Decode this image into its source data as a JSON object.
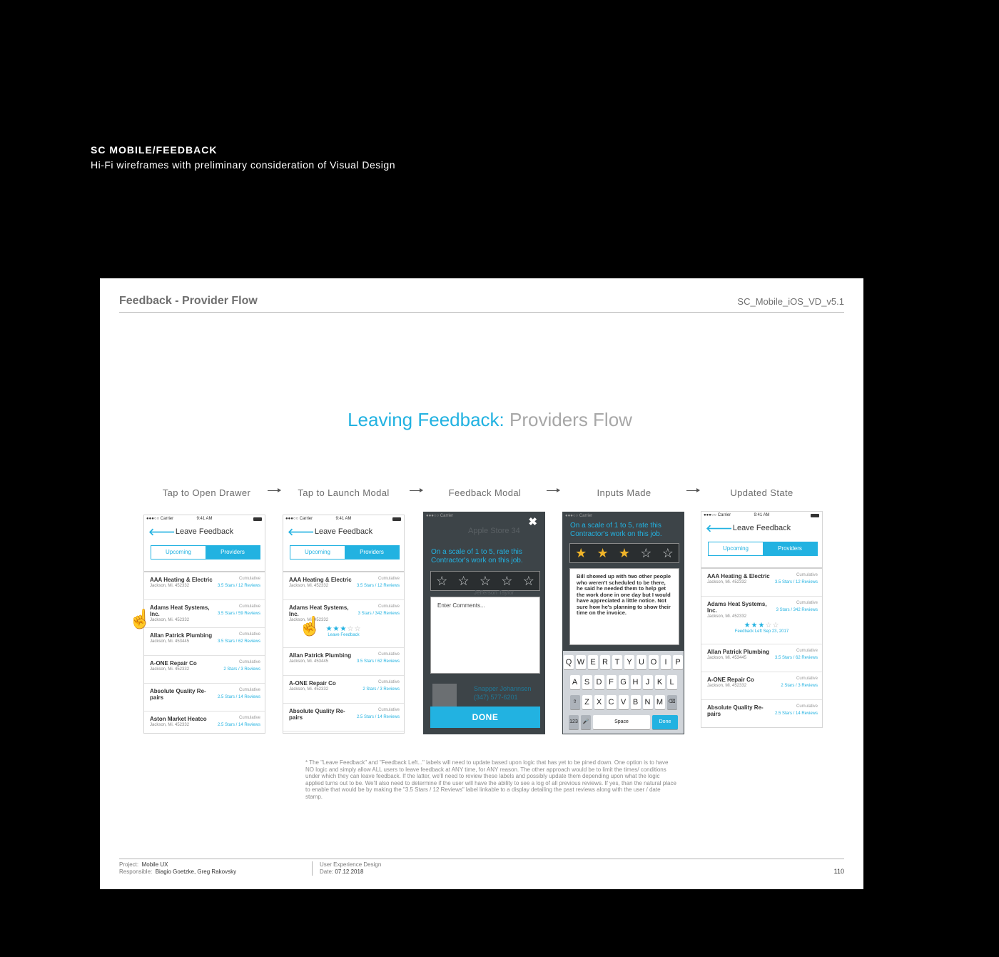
{
  "header": {
    "title": "SC MOBILE/FEEDBACK",
    "subtitle": "Hi-Fi wireframes with preliminary consideration of Visual Design"
  },
  "sheet": {
    "title": "Feedback - Provider Flow",
    "doc_id": "SC_Mobile_iOS_VD_v5.1",
    "heading_accent": "Leaving Feedback:",
    "heading_rest": " Providers Flow"
  },
  "steps": [
    "Tap to Open Drawer",
    "Tap to Launch Modal",
    "Feedback Modal",
    "Inputs Made",
    "Updated State"
  ],
  "phone": {
    "carrier": "●●●○○ Carrier",
    "time": "9:41 AM",
    "nav_title": "Leave Feedback",
    "tab_upcoming": "Upcoming",
    "tab_providers": "Providers",
    "cumulative": "Cumulative"
  },
  "screen1": {
    "rows": [
      {
        "name": "AAA Heating & Electric",
        "loc": "Jackson, Mi. 452332",
        "rating": "3.5 Stars  /  12 Reviews"
      },
      {
        "name": "Adams Heat Systems, Inc.",
        "loc": "Jackson, Mi. 452332",
        "rating": "3.5 Stars  /  59 Reviews"
      },
      {
        "name": "Allan Patrick Plumbing",
        "loc": "Jackson, Mi. 453445",
        "rating": "3.5 Stars  /  62 Reviews"
      },
      {
        "name": "A-ONE Repair Co",
        "loc": "Jackson, Mi. 452332",
        "rating": "2 Stars  /  3 Reviews"
      },
      {
        "name": "Absolute Quality Re-pairs",
        "loc": "",
        "rating": "2.5 Stars  /  14 Reviews"
      },
      {
        "name": "Aston Market Heatco",
        "loc": "Jackson, Mi. 452332",
        "rating": "2.5 Stars  /  14 Reviews"
      }
    ]
  },
  "screen2": {
    "rows": [
      {
        "name": "AAA Heating & Electric",
        "loc": "Jackson, Mi. 452332",
        "rating": "3.5 Stars  /  12 Reviews"
      },
      {
        "name": "Adams Heat Systems, Inc.",
        "loc": "Jackson, Mi. 452332",
        "rating": "3 Stars  /  342 Reviews"
      },
      {
        "name": "Allan Patrick Plumbing",
        "loc": "Jackson, Mi. 453445",
        "rating": "3.5 Stars  /  62 Reviews"
      },
      {
        "name": "A-ONE Repair Co",
        "loc": "Jackson, Mi. 452332",
        "rating": "2 Stars  /  3 Reviews"
      },
      {
        "name": "Absolute Quality Re-pairs",
        "loc": "",
        "rating": "2.5 Stars  /  14 Reviews"
      }
    ],
    "leave_feedback": "Leave Feedback",
    "stars_filled": 3,
    "stars_total": 5
  },
  "screen3": {
    "bg_title": "Apple Store 34",
    "prompt": "On a scale of 1 to 5, rate this Contractor's work on this job.",
    "placeholder": "Enter Comments...",
    "bg_name": "Snapper Johannsen",
    "bg_phone": "(347) 577-6201",
    "bg_name2": "Jefferson Taylor",
    "done": "DONE"
  },
  "screen4": {
    "prompt": "On a scale of 1 to 5, rate this Contractor's work on this job.",
    "comment": "Bill showed up with two other people who weren't scheduled to be there, he said he needed them to help get the work done in one day but I would have appreciated a little notice. Not sure how he's planning to show their time on the invoice.",
    "stars_filled": 3,
    "keys_row1": [
      "Q",
      "W",
      "E",
      "R",
      "T",
      "Y",
      "U",
      "O",
      "I",
      "P"
    ],
    "keys_row2": [
      "A",
      "S",
      "D",
      "F",
      "G",
      "H",
      "J",
      "K",
      "L"
    ],
    "keys_row3": [
      "Z",
      "X",
      "C",
      "V",
      "B",
      "N",
      "M"
    ],
    "key_123": "123",
    "key_space": "Space",
    "key_done": "Done"
  },
  "screen5": {
    "rows": [
      {
        "name": "AAA Heating & Electric",
        "loc": "Jackson, Mi. 452332",
        "rating": "3.5 Stars  /  12 Reviews"
      },
      {
        "name": "Adams Heat Systems, Inc.",
        "loc": "Jackson, Mi. 452332",
        "rating": "3 Stars  /  342 Reviews"
      },
      {
        "name": "Allan Patrick Plumbing",
        "loc": "Jackson, Mi. 453445",
        "rating": "3.5 Stars  /  62 Reviews"
      },
      {
        "name": "A-ONE Repair Co",
        "loc": "Jackson, Mi. 452332",
        "rating": "2 Stars  /  3 Reviews"
      },
      {
        "name": "Absolute Quality Re-pairs",
        "loc": "",
        "rating": "2.5 Stars  /  14 Reviews"
      }
    ],
    "feedback_left": "Feedback Left Sep 23, 2017",
    "stars_filled": 3
  },
  "footnote": "* The \"Leave Feedback\" and \"Feedback Left...\" labels will need to update based upon logic that has yet to be pined down. One option is to have NO logic and simply allow ALL users to leave feedback at ANY time, for ANY reason. The other approach would be to limit the times/ conditions under which they can leave feedback. If the latter, we'll need to review these labels and possibly update them depending upon what the logic applied turns out to be. We'll also need to determine if the user will have the ability to see a log of all previous reviews. If yes, than the natural place to enable that would be by making the \"3.5 Stars / 12 Reviews\" label linkable to a display detailing the past reviews along with the user / date stamp.",
  "footer": {
    "project_label": "Project:",
    "project": "Mobile UX",
    "responsible_label": "Responsible:",
    "responsible": "Biagio Goetzke, Greg Rakovsky",
    "discipline": "User Experience Design",
    "date_label": "Date:",
    "date": "07.12.2018",
    "page": "110"
  },
  "colors": {
    "accent": "#22b2e1",
    "star": "#f0b429",
    "modal_bg": "#3d4448"
  }
}
